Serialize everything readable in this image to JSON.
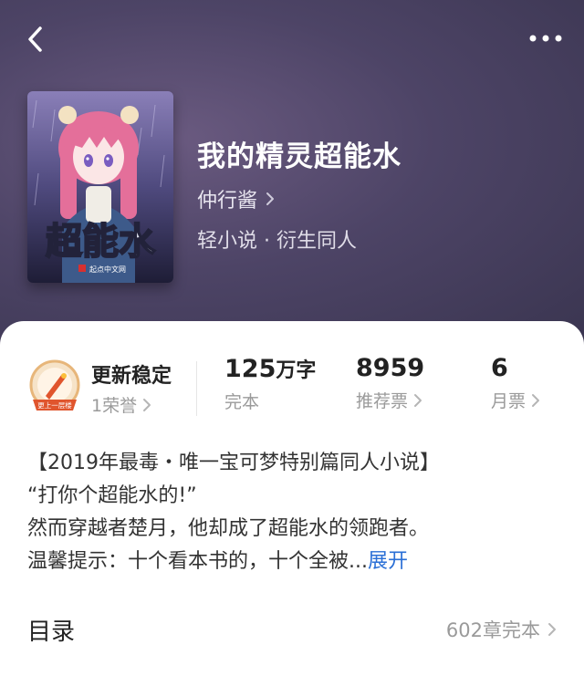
{
  "header": {
    "back_icon": "chevron-left-icon",
    "more_icon": "more-horizontal-icon"
  },
  "book": {
    "title": "我的精灵超能水",
    "author": "仲行酱",
    "genre": "轻小说 · 衍生同人",
    "cover": {
      "title_text": "超能水",
      "publisher_text": "起点中文网"
    }
  },
  "honor": {
    "badge_text": "更上一层楼",
    "title": "更新稳定",
    "subtitle": "1荣誉"
  },
  "stats": [
    {
      "value": "125",
      "unit": "万字",
      "label": "完本"
    },
    {
      "value": "8959",
      "unit": "",
      "label": "推荐票"
    },
    {
      "value": "6",
      "unit": "",
      "label": "月票"
    }
  ],
  "description": {
    "lines": [
      "【2019年最毒・唯一宝可梦特别篇同人小说】",
      "“打你个超能水的!”",
      "然而穿越者楚月，他却成了超能水的领跑者。",
      "温馨提示：十个看本书的，十个全被..."
    ],
    "expand_label": "展开"
  },
  "toc": {
    "title": "目录",
    "summary": "602章完本"
  },
  "colors": {
    "header_bg": "#4d4466",
    "link": "#2a6fd6",
    "muted": "#9a9a9a",
    "text": "#222222"
  }
}
